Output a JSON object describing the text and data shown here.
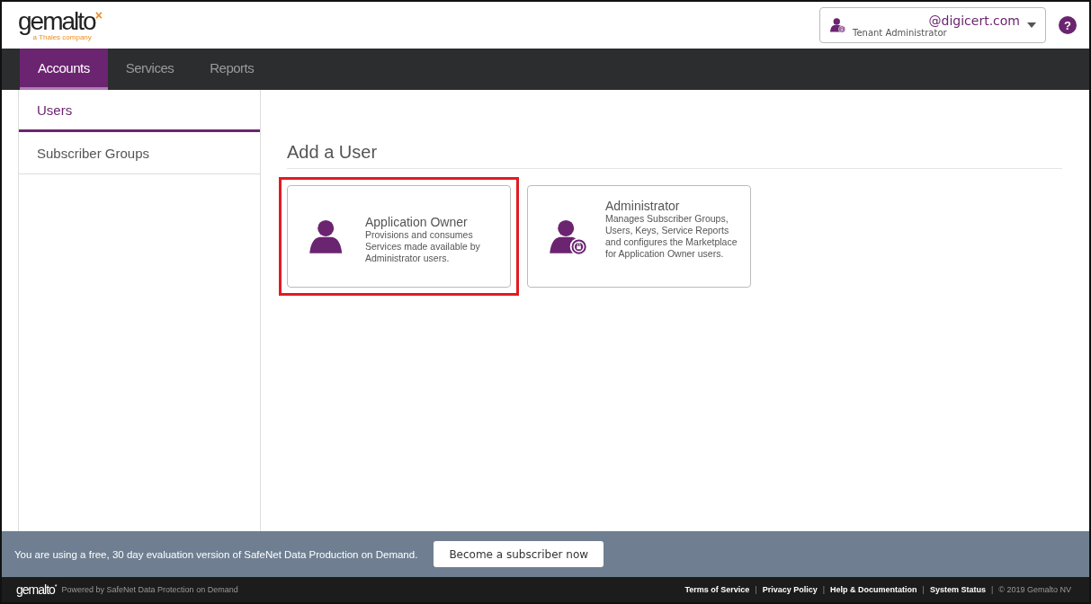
{
  "header": {
    "logo": "gemalto",
    "logo_mark": "×",
    "logo_tagline": "a Thales company",
    "account": {
      "email": "@digicert.com",
      "role": "Tenant Administrator"
    },
    "help": "?"
  },
  "nav": {
    "tabs": [
      {
        "label": "Accounts",
        "selected": true
      },
      {
        "label": "Services",
        "selected": false
      },
      {
        "label": "Reports",
        "selected": false
      }
    ]
  },
  "sidebar": {
    "items": [
      {
        "label": "Users",
        "selected": true
      },
      {
        "label": "Subscriber Groups",
        "selected": false
      }
    ]
  },
  "main": {
    "heading": "Add a User",
    "cards": [
      {
        "kind": "owner",
        "title": "Application Owner",
        "description": "Provisions and consumes Services made available by Administrator users.",
        "highlighted": true
      },
      {
        "kind": "admin",
        "title": "Administrator",
        "description": "Manages Subscriber Groups, Users, Keys, Service Reports and configures the Marketplace for Application Owner users.",
        "highlighted": false
      }
    ]
  },
  "banner": {
    "message": "You are using a free, 30 day evaluation version of SafeNet Data Production on Demand.",
    "button": "Become a subscriber now"
  },
  "footer": {
    "logo": "gemalto",
    "logo_mark": "*",
    "powered_by": "Powered by SafeNet Data Protection on Demand",
    "separator": "|",
    "links": [
      "Terms of Service",
      "Privacy Policy",
      "Help & Documentation",
      "System Status"
    ],
    "copyright": "© 2019 Gemalto NV"
  }
}
